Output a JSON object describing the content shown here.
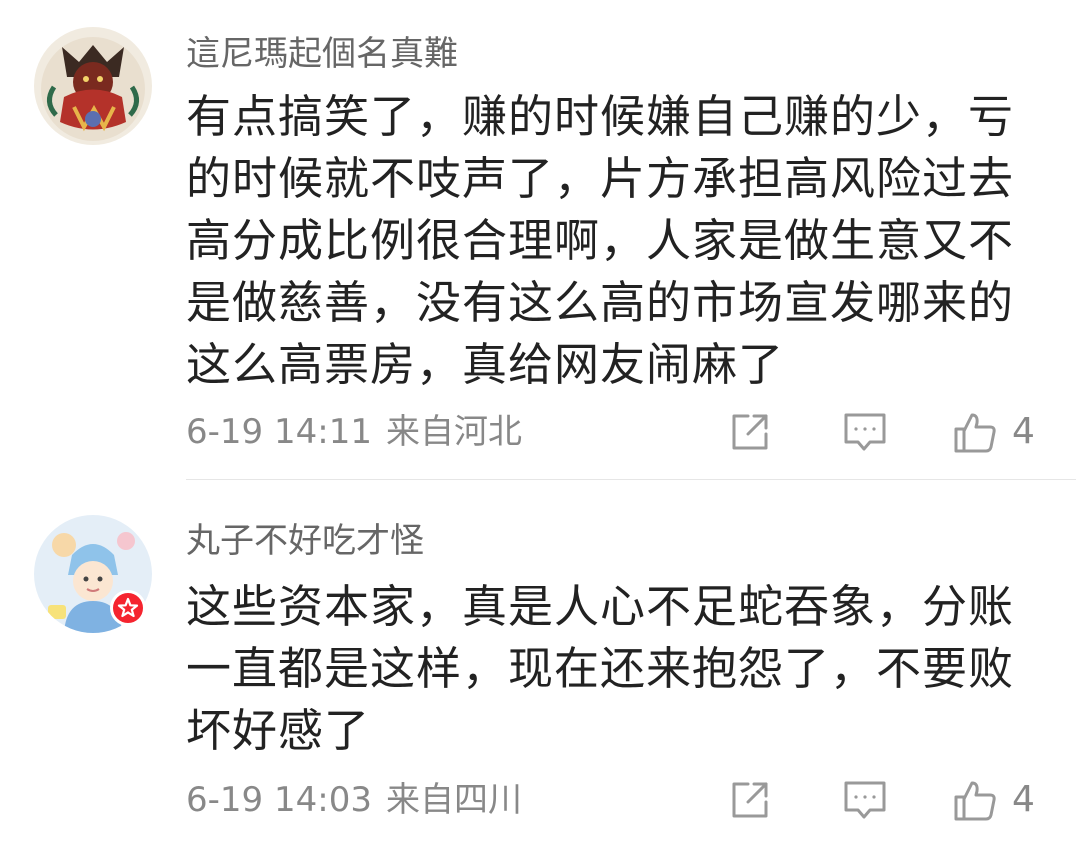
{
  "comments": [
    {
      "username": "這尼瑪起個名真難",
      "text": "有点搞笑了，赚的时候嫌自己赚的少，亏的时候就不吱声了，片方承担高风险过去高分成比例很合理啊，人家是做生意又不是做慈善，没有这么高的市场宣发哪来的这么高票房，真给网友闹麻了",
      "date": "6-19 14:11",
      "location": "来自河北",
      "likes": "4"
    },
    {
      "username": "丸子不好吃才怪",
      "text": "这些资本家，真是人心不足蛇吞象，分账一直都是这样，现在还来抱怨了，不要败坏好感了",
      "date": "6-19 14:03",
      "location": "来自四川",
      "likes": "4"
    }
  ],
  "colors": {
    "username": "#666666",
    "text": "#222222",
    "meta": "#888888",
    "icon": "#999999",
    "badge": "#f5242f"
  },
  "icons": {
    "share": "share-icon",
    "comment": "comment-icon",
    "like": "thumbs-up-icon",
    "badge": "star-badge-icon"
  }
}
